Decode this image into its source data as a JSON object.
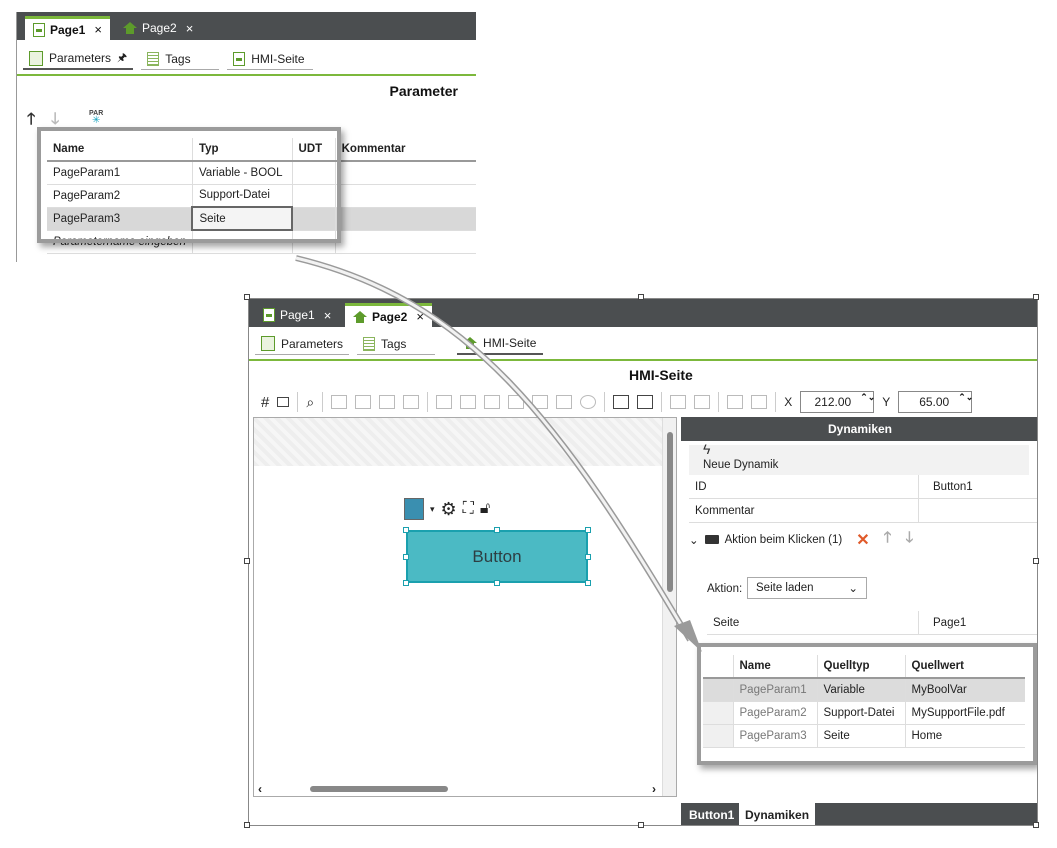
{
  "panel1": {
    "tabs": [
      {
        "label": "Page1",
        "close": "×"
      },
      {
        "label": "Page2",
        "close": "×"
      }
    ],
    "subtabs": {
      "parameters": "Parameters",
      "pin": "🖈",
      "tags": "Tags",
      "hmi": "HMI-Seite"
    },
    "title": "Parameter",
    "par_icon": "PAR",
    "table": {
      "headers": {
        "name": "Name",
        "typ": "Typ",
        "udt": "UDT",
        "kommentar": "Kommentar"
      },
      "rows": [
        {
          "name": "PageParam1",
          "typ": "Variable - BOOL"
        },
        {
          "name": "PageParam2",
          "typ": "Support-Datei"
        },
        {
          "name": "PageParam3",
          "typ": "Seite"
        }
      ],
      "placeholder": "Parametername eingeben"
    }
  },
  "panel2": {
    "tabs": [
      {
        "label": "Page1",
        "close": "×"
      },
      {
        "label": "Page2",
        "close": "×"
      }
    ],
    "subtabs": {
      "parameters": "Parameters",
      "tags": "Tags",
      "hmi": "HMI-Seite"
    },
    "title": "HMI-Seite",
    "coords": {
      "x_label": "X",
      "x_value": "212.00",
      "y_label": "Y",
      "y_value": "65.00"
    },
    "canvas": {
      "button_label": "Button"
    },
    "dynamics": {
      "header": "Dynamiken",
      "new_label": "Neue Dynamik",
      "id_label": "ID",
      "id_value": "Button1",
      "comment_label": "Kommentar",
      "action_group": "Aktion beim Klicken (1)",
      "action_label": "Aktion:",
      "action_value": "Seite laden",
      "seite_label": "Seite",
      "seite_value": "Page1",
      "table": {
        "headers": {
          "name": "Name",
          "quelltyp": "Quelltyp",
          "quellwert": "Quellwert"
        },
        "rows": [
          {
            "name": "PageParam1",
            "quelltyp": "Variable",
            "quellwert": "MyBoolVar"
          },
          {
            "name": "PageParam2",
            "quelltyp": "Support-Datei",
            "quellwert": "MySupportFile.pdf"
          },
          {
            "name": "PageParam3",
            "quelltyp": "Seite",
            "quellwert": "Home"
          }
        ]
      },
      "bottom_tabs": [
        "Button1",
        "Dynamiken"
      ]
    }
  },
  "colors": {
    "accent": "#7cb83c",
    "dark_bar": "#4b4e50",
    "button_fill": "#4bbac4"
  }
}
